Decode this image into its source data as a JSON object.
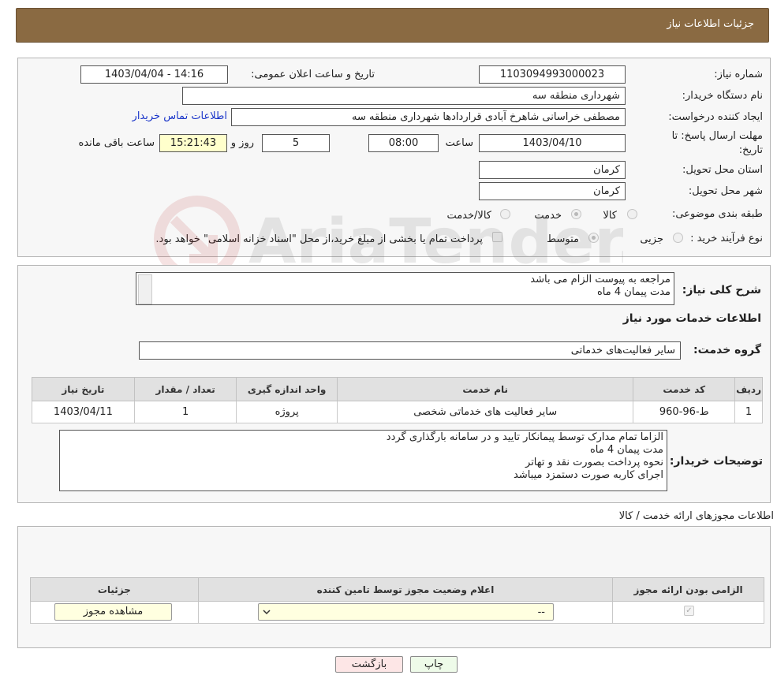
{
  "header": {
    "title": "جزئیات اطلاعات نیاز"
  },
  "need_info": {
    "need_number_label": "شماره نیاز:",
    "need_number": "1103094993000023",
    "announce_label": "تاریخ و ساعت اعلان عمومی:",
    "announce_value": "1403/04/04 - 14:16",
    "buyer_org_label": "نام دستگاه خریدار:",
    "buyer_org": "شهرداری منطقه سه",
    "creator_label": "ایجاد کننده درخواست:",
    "creator": "مصطفی خراسانی شاهرخ آبادی قراردادها شهرداری منطقه سه",
    "contact_link": "اطلاعات تماس خریدار",
    "deadline_label_1": "مهلت ارسال پاسخ: تا",
    "deadline_label_2": "تاریخ:",
    "deadline_date": "1403/04/10",
    "time_label": "ساعت",
    "deadline_time": "08:00",
    "days_value": "5",
    "days_label": "روز و",
    "remaining_time": "15:21:43",
    "remaining_label": "ساعت باقی مانده",
    "province_label": "استان محل تحویل:",
    "province": "کرمان",
    "city_label": "شهر محل تحویل:",
    "city": "کرمان",
    "category_label": "طبقه بندی موضوعی:",
    "category_options": [
      "کالا",
      "خدمت",
      "کالا/خدمت"
    ],
    "category_selected": "خدمت",
    "purchase_type_label": "نوع فرآیند خرید :",
    "purchase_options": [
      "جزیی",
      "متوسط"
    ],
    "purchase_selected": "متوسط",
    "payment_note": "پرداخت تمام یا بخشی از مبلغ خرید،از محل \"اسناد خزانه اسلامی\" خواهد بود."
  },
  "description": {
    "label": "شرح کلی نیاز:",
    "lines": [
      "مراجعه به پیوست الزام می باشد",
      "مدت پیمان 4 ماه"
    ]
  },
  "services": {
    "section_title": "اطلاعات خدمات مورد نیاز",
    "group_label": "گروه خدمت:",
    "group_value": "سایر فعالیت‌های خدماتی",
    "table_headers": [
      "ردیف",
      "کد خدمت",
      "نام خدمت",
      "واحد اندازه گیری",
      "تعداد / مقدار",
      "تاریخ نیاز"
    ],
    "rows": [
      {
        "index": "1",
        "code": "ط-96-960",
        "name": "سایر فعالیت های خدماتی شخصی",
        "unit": "پروژه",
        "qty": "1",
        "date": "1403/04/11"
      }
    ]
  },
  "buyer_notes": {
    "label": "توضیحات خریدار:",
    "lines": [
      "الزاما تمام مدارک توسط پیمانکار تایید و در سامانه بارگذاری گردد",
      "مدت پیمان 4 ماه",
      "نحوه پرداخت بصورت نقد و تهاتر",
      "اجرای کاربه صورت دستمزد میباشد"
    ]
  },
  "permits": {
    "section_title": "اطلاعات مجوزهای ارائه خدمت / کالا",
    "table_headers": [
      "الزامی بودن ارائه مجوز",
      "اعلام وضعیت مجوز توسط تامین کننده",
      "جزئیات"
    ],
    "select_value": "--",
    "view_button": "مشاهده مجوز"
  },
  "footer": {
    "print_button": "چاپ",
    "back_button": "بازگشت"
  },
  "watermark": {
    "text": "AriaTender.neT"
  }
}
